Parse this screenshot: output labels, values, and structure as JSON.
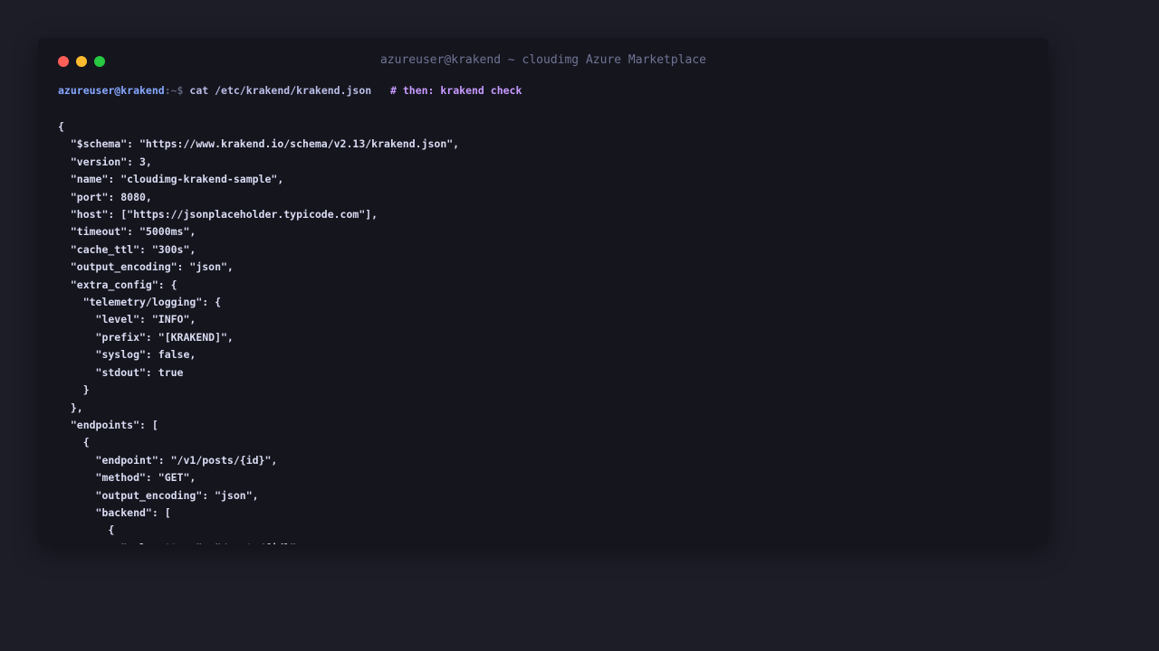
{
  "window": {
    "title": "azureuser@krakend ~ cloudimg Azure Marketplace"
  },
  "prompt": {
    "user_host": "azureuser@krakend",
    "path_sign": ":~$",
    "command": "cat /etc/krakend/krakend.json",
    "comment": "# then: krakend check"
  },
  "output_lines": [
    "{",
    "  \"$schema\": \"https://www.krakend.io/schema/v2.13/krakend.json\",",
    "  \"version\": 3,",
    "  \"name\": \"cloudimg-krakend-sample\",",
    "  \"port\": 8080,",
    "  \"host\": [\"https://jsonplaceholder.typicode.com\"],",
    "  \"timeout\": \"5000ms\",",
    "  \"cache_ttl\": \"300s\",",
    "  \"output_encoding\": \"json\",",
    "  \"extra_config\": {",
    "    \"telemetry/logging\": {",
    "      \"level\": \"INFO\",",
    "      \"prefix\": \"[KRAKEND]\",",
    "      \"syslog\": false,",
    "      \"stdout\": true",
    "    }",
    "  },",
    "  \"endpoints\": [",
    "    {",
    "      \"endpoint\": \"/v1/posts/{id}\",",
    "      \"method\": \"GET\",",
    "      \"output_encoding\": \"json\",",
    "      \"backend\": [",
    "        {",
    "          \"url_pattern\": \"/posts/{id}\","
  ],
  "colors": {
    "background": "#1d1d28",
    "terminal": "#15151e",
    "user_host": "#86a8ff",
    "command": "#b9bde6",
    "comment": "#c79bff",
    "output": "#d9dcf2"
  }
}
